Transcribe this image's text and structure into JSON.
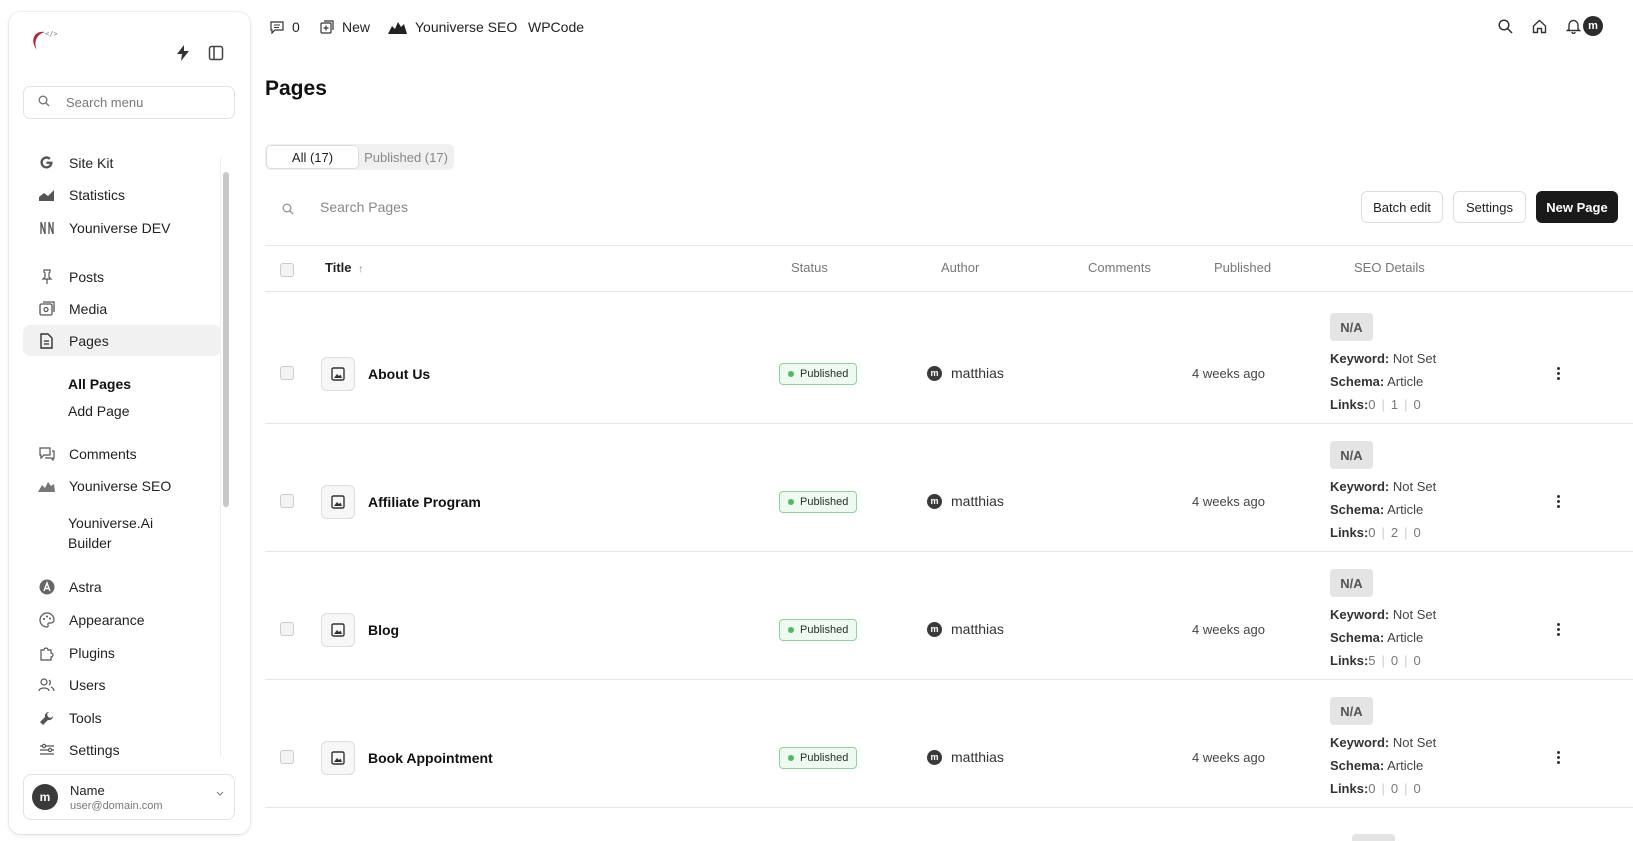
{
  "sidebar": {
    "search_placeholder": "Search menu",
    "groups": [
      {
        "label": "Site Kit",
        "icon": "google-icon"
      },
      {
        "label": "Statistics",
        "icon": "chart-icon"
      },
      {
        "label": "Youniverse DEV",
        "icon": "dev-icon"
      },
      {
        "label": "Posts",
        "icon": "pin-icon"
      },
      {
        "label": "Media",
        "icon": "media-icon"
      },
      {
        "label": "Pages",
        "icon": "page-icon"
      },
      {
        "label": "Comments",
        "icon": "comments-icon"
      },
      {
        "label": "Youniverse SEO",
        "icon": "seo-icon"
      },
      {
        "label": "Youniverse.Ai",
        "icon": ""
      },
      {
        "label": "Astra",
        "icon": "astra-icon"
      },
      {
        "label": "Appearance",
        "icon": "palette-icon"
      },
      {
        "label": "Plugins",
        "icon": "plugin-icon"
      },
      {
        "label": "Users",
        "icon": "users-icon"
      },
      {
        "label": "Tools",
        "icon": "wrench-icon"
      },
      {
        "label": "Settings",
        "icon": "settings-icon"
      }
    ],
    "ai_second_line": "Builder",
    "sub_items": [
      "All Pages",
      "Add Page"
    ],
    "user": {
      "initial": "m",
      "name": "Name",
      "email": "user@domain.com"
    }
  },
  "topbar": {
    "comments_count": "0",
    "new_label": "New",
    "seo_label": "Youniverse SEO",
    "wpcode_label": "WPCode",
    "avatar_initial": "m"
  },
  "main": {
    "title": "Pages",
    "tabs": [
      {
        "label": "All (17)"
      },
      {
        "label": "Published (17)"
      }
    ],
    "search_placeholder": "Search Pages",
    "buttons": {
      "batch_edit": "Batch edit",
      "settings": "Settings",
      "new_page": "New Page"
    },
    "columns": {
      "title": "Title",
      "sort_arrow": "↑",
      "status": "Status",
      "author": "Author",
      "comments": "Comments",
      "published": "Published",
      "seo": "SEO Details"
    },
    "rows": [
      {
        "title": "About Us",
        "status": "Published",
        "author_initial": "m",
        "author": "matthias",
        "published": "4 weeks ago",
        "seo_score": "N/A",
        "keyword_label": "Keyword:",
        "keyword": "Not Set",
        "schema_label": "Schema:",
        "schema": "Article",
        "links_label": "Links:",
        "links": [
          "0",
          "1",
          "0"
        ]
      },
      {
        "title": "Affiliate Program",
        "status": "Published",
        "author_initial": "m",
        "author": "matthias",
        "published": "4 weeks ago",
        "seo_score": "N/A",
        "keyword_label": "Keyword:",
        "keyword": "Not Set",
        "schema_label": "Schema:",
        "schema": "Article",
        "links_label": "Links:",
        "links": [
          "0",
          "2",
          "0"
        ]
      },
      {
        "title": "Blog",
        "status": "Published",
        "author_initial": "m",
        "author": "matthias",
        "published": "4 weeks ago",
        "seo_score": "N/A",
        "keyword_label": "Keyword:",
        "keyword": "Not Set",
        "schema_label": "Schema:",
        "schema": "Article",
        "links_label": "Links:",
        "links": [
          "5",
          "0",
          "0"
        ]
      },
      {
        "title": "Book Appointment",
        "status": "Published",
        "author_initial": "m",
        "author": "matthias",
        "published": "4 weeks ago",
        "seo_score": "N/A",
        "keyword_label": "Keyword:",
        "keyword": "Not Set",
        "schema_label": "Schema:",
        "schema": "Article",
        "links_label": "Links:",
        "links": [
          "0",
          "0",
          "0"
        ]
      }
    ]
  },
  "colors": {
    "accent": "#1a1a1a",
    "status_border": "#8fd19e",
    "status_dot": "#4cbb63",
    "logo": "#b3263a"
  }
}
